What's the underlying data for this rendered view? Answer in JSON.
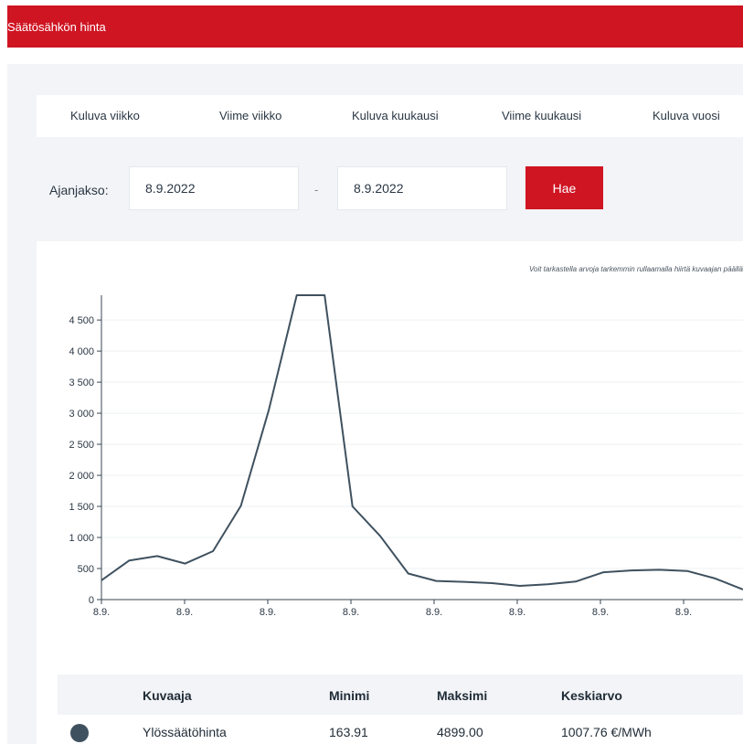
{
  "header": {
    "title": "Säätösähkön hinta"
  },
  "tabs": [
    "Kuluva viikko",
    "Viime viikko",
    "Kuluva kuukausi",
    "Viime kuukausi",
    "Kuluva vuosi"
  ],
  "period": {
    "label": "Ajanjakso:",
    "start": "8.9.2022",
    "separator": "-",
    "end": "8.9.2022",
    "button": "Hae"
  },
  "hint": "Voit tarkastella arvoja tarkemmin rullaamalla hiirtä kuvaajan päällä",
  "colors": {
    "accent": "#cf1422",
    "series": "#3f515f",
    "panel": "#f2f4f7"
  },
  "chart_data": {
    "type": "line",
    "ylim": [
      0,
      4899
    ],
    "yticks": [
      0,
      500,
      1000,
      1500,
      2000,
      2500,
      3000,
      3500,
      4000,
      4500
    ],
    "ytick_labels": [
      "0",
      "500",
      "1 000",
      "1 500",
      "2 000",
      "2 500",
      "3 000",
      "3 500",
      "4 000",
      "4 500"
    ],
    "xtick_labels": [
      "8.9.",
      "8.9.",
      "8.9.",
      "8.9.",
      "8.9.",
      "8.9.",
      "8.9.",
      "8.9."
    ],
    "grid": true,
    "series": [
      {
        "name": "Ylössäätöhinta",
        "color": "#3f515f",
        "values": [
          310,
          630,
          700,
          580,
          780,
          1510,
          3050,
          4899,
          4899,
          1500,
          1020,
          420,
          300,
          285,
          265,
          220,
          245,
          290,
          440,
          470,
          480,
          460,
          340,
          163.91
        ]
      }
    ]
  },
  "table": {
    "headers": [
      "Kuvaaja",
      "Minimi",
      "Maksimi",
      "Keskiarvo"
    ],
    "rows": [
      {
        "name": "Ylössäätöhinta",
        "min": "163.91",
        "max": "4899.00",
        "avg": "1007.76 €/MWh"
      }
    ]
  }
}
